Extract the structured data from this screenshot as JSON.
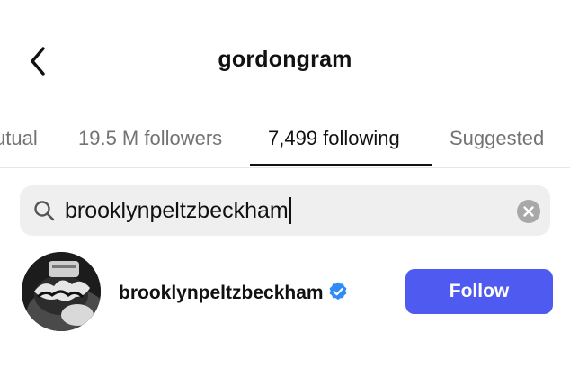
{
  "header": {
    "title": "gordongram",
    "back_icon": "chevron-left-icon"
  },
  "tabs": [
    {
      "label": "Mutual",
      "visible_text": "utual"
    },
    {
      "label": "19.5 M followers"
    },
    {
      "label": "7,499 following",
      "active": true
    },
    {
      "label": "Suggested"
    }
  ],
  "search": {
    "query": "brooklynpeltzbeckham",
    "search_icon": "search-icon",
    "clear_icon": "clear-icon"
  },
  "results": [
    {
      "username": "brooklynpeltzbeckham",
      "verified": true,
      "follow_label": "Follow"
    }
  ],
  "colors": {
    "accent": "#4f5bf0",
    "verified": "#2f8bf7",
    "muted_text": "#737373",
    "search_bg": "#efefef"
  }
}
